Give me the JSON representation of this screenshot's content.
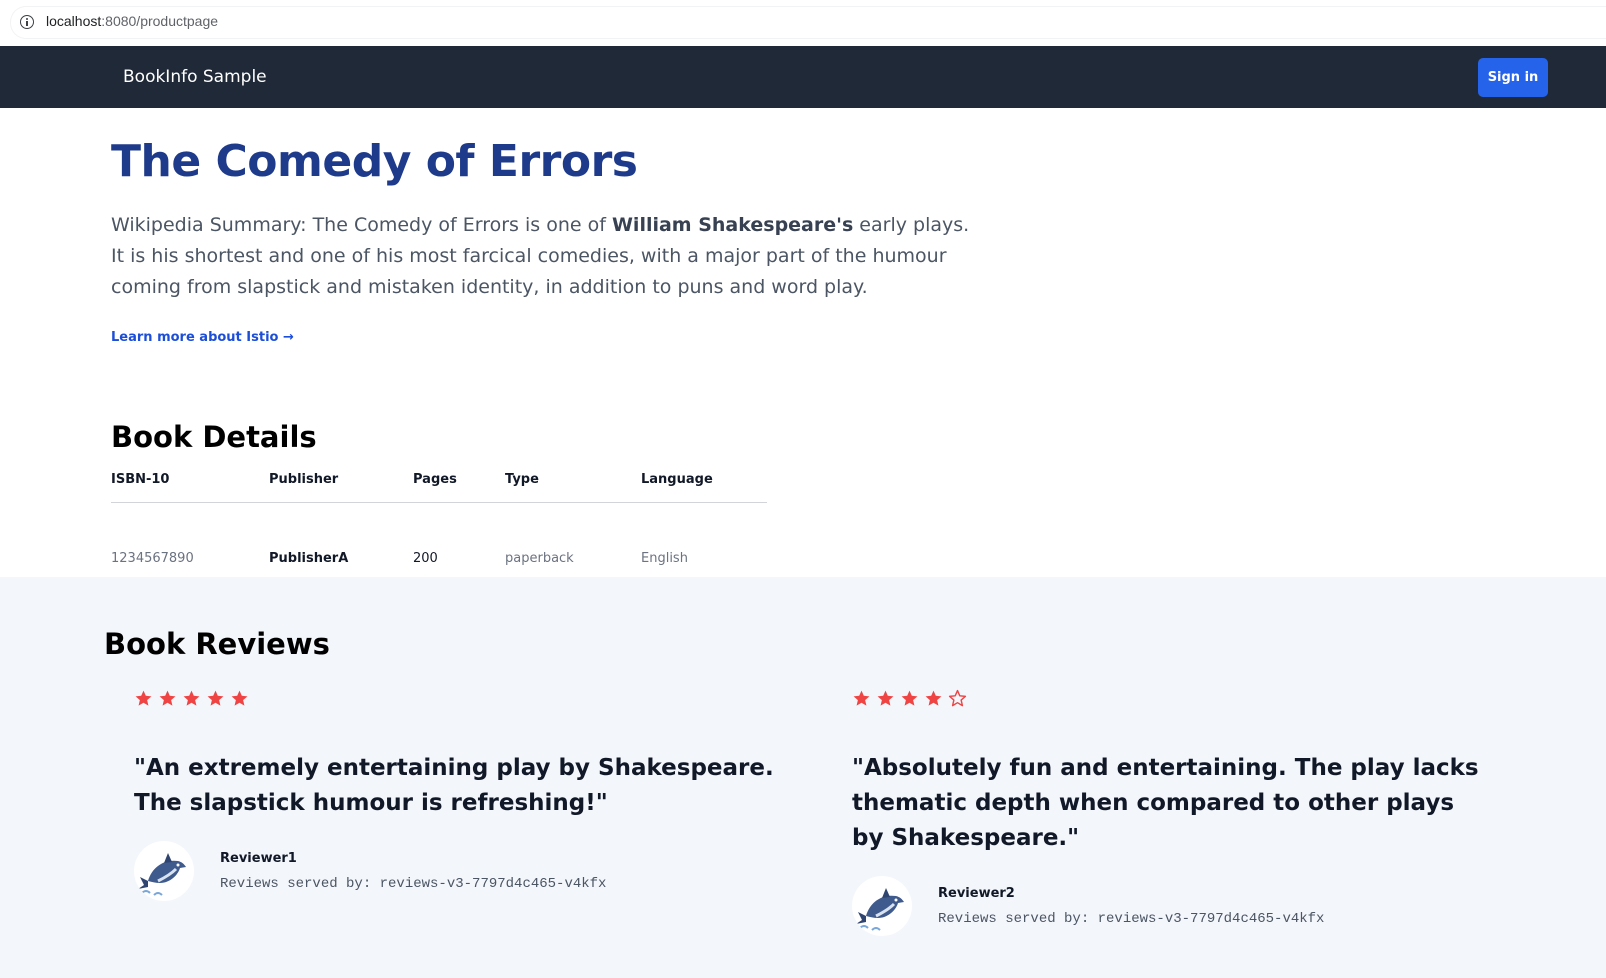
{
  "browser": {
    "url_host": "localhost",
    "url_rest": ":8080/productpage"
  },
  "navbar": {
    "brand": "BookInfo Sample",
    "signin_label": "Sign in"
  },
  "hero": {
    "title": "The Comedy of Errors",
    "summary_prefix": "Wikipedia Summary: The Comedy of Errors is one of ",
    "summary_bold": "William Shakespeare's",
    "summary_suffix": " early plays. It is his shortest and one of his most farcical comedies, with a major part of the humour coming from slapstick and mistaken identity, in addition to puns and word play.",
    "learn_more": "Learn more about Istio →"
  },
  "details": {
    "title": "Book Details",
    "headers": [
      "ISBN-10",
      "Publisher",
      "Pages",
      "Type",
      "Language"
    ],
    "values": [
      "1234567890",
      "PublisherA",
      "200",
      "paperback",
      "English"
    ]
  },
  "reviews": {
    "title": "Book Reviews",
    "star_color": "#ef4444",
    "items": [
      {
        "rating": 5,
        "max": 5,
        "text": "\"An extremely entertaining play by Shakespeare. The slapstick humour is refreshing!\"",
        "reviewer": "Reviewer1",
        "served_by": "Reviews served by: reviews-v3-7797d4c465-v4kfx",
        "avatar_icon": "dolphin-icon"
      },
      {
        "rating": 4,
        "max": 5,
        "text": "\"Absolutely fun and entertaining. The play lacks thematic depth when compared to other plays by Shakespeare.\"",
        "reviewer": "Reviewer2",
        "served_by": "Reviews served by: reviews-v3-7797d4c465-v4kfx",
        "avatar_icon": "dolphin-icon"
      }
    ]
  }
}
